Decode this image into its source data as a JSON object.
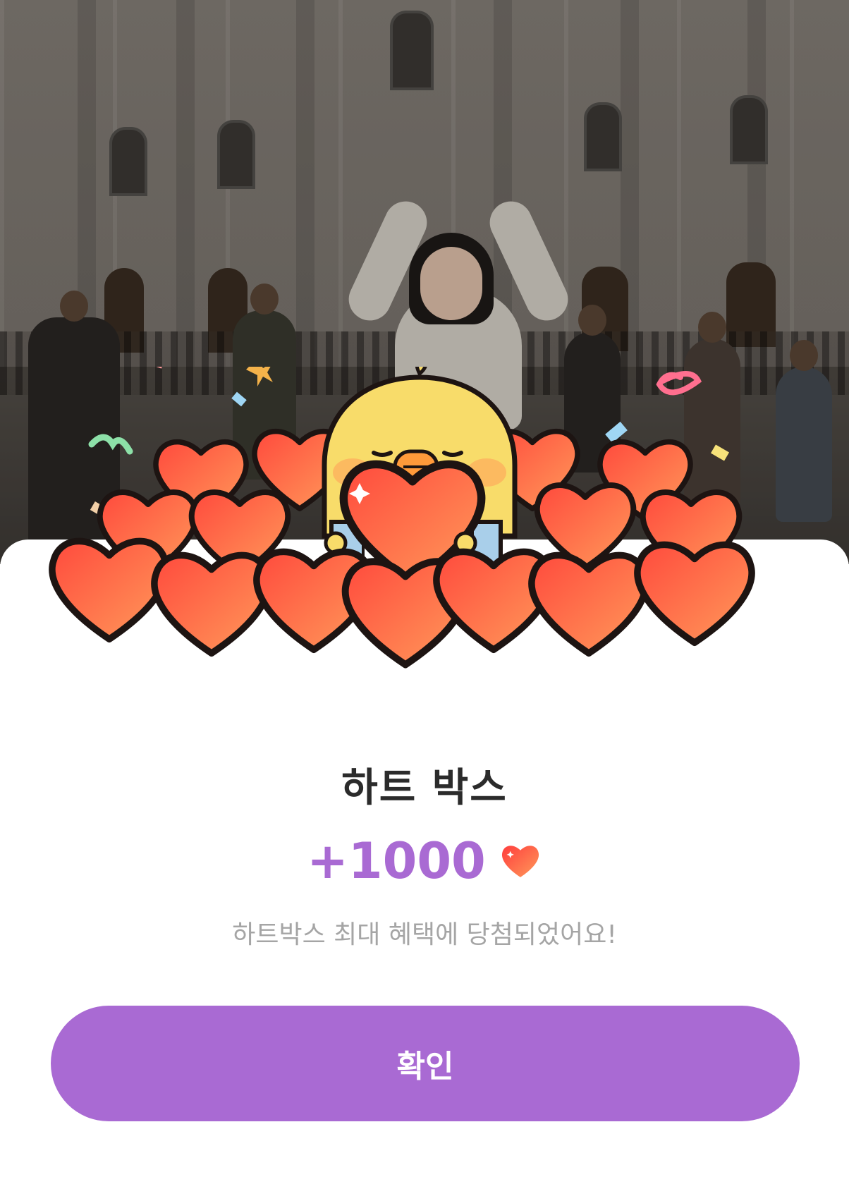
{
  "reward": {
    "title": "하트 박스",
    "amount": "+1000",
    "description": "하트박스 최대 혜택에 당첨되었어요!",
    "confirm_label": "확인"
  },
  "colors": {
    "accent": "#a96ad3",
    "heart_gradient_start": "#ff4a3d",
    "heart_gradient_end": "#ff9a5a",
    "chick": "#f8dc6a",
    "beak": "#ff9a3a"
  },
  "icons": {
    "amount_heart": "heart-icon"
  }
}
